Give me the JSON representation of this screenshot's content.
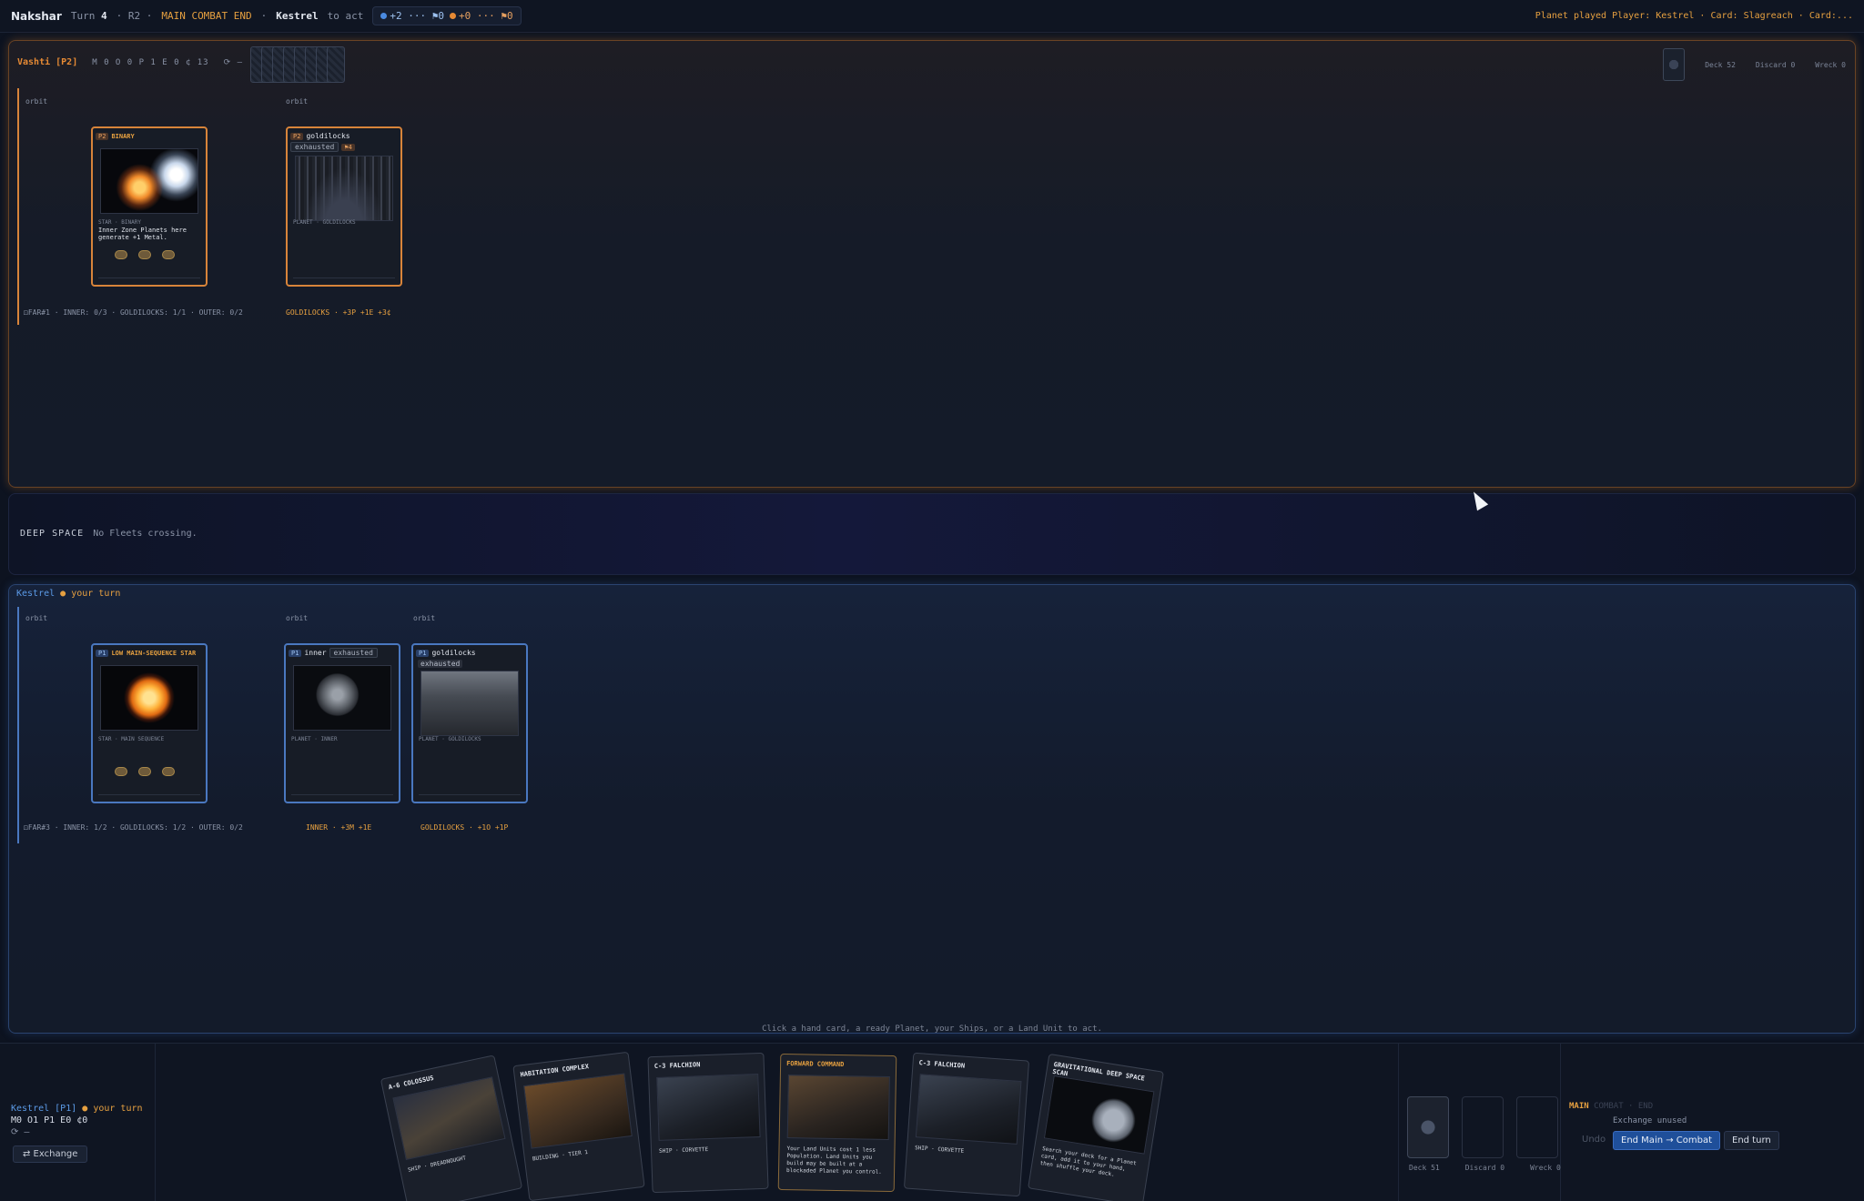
{
  "topbar": {
    "brand": "Nakshar",
    "turn_label": "Turn",
    "turn_num": "4",
    "round": "· R2 ·",
    "phase": "MAIN COMBAT END",
    "sep": "·",
    "active_player": "Kestrel",
    "to_act": "to act",
    "pill_blue": "+2 ··· ⚑0",
    "pill_orange": "+0 ··· ⚑0",
    "log": "Planet played Player: Kestrel · Card: Slagreach · Card:..."
  },
  "opponent": {
    "name": "Vashti [P2]",
    "resources": "M 0  O 0  P 1  E 0  ¢ 13",
    "extra": "⟳ —",
    "deck": "Deck 52",
    "discard": "Discard 0",
    "wreck": "Wreck 0",
    "lanes": [
      {
        "orbit": "orbit",
        "footer": "⚀FAR#1 · INNER: 0/3 · GOLDILOCKS: 1/1 · OUTER: 0/2"
      },
      {
        "orbit": "orbit",
        "footer": "GOLDILOCKS · +3P +1E +3¢"
      }
    ],
    "cards": [
      {
        "tag": "P2",
        "name": "BINARY",
        "type": "STAR · BINARY",
        "text": "Inner Zone Planets here generate +1 Metal.",
        "stats": [
          "3",
          "1",
          "3"
        ]
      },
      {
        "tag": "P2",
        "name": "goldilocks",
        "exhausted": "exhausted",
        "badge": "⚑4",
        "type": "PLANET · GOLDILOCKS"
      }
    ]
  },
  "deep_space": {
    "label": "DEEP SPACE",
    "status": "No Fleets crossing."
  },
  "mine": {
    "name": "Kestrel",
    "your_turn": "● your turn",
    "lanes": [
      {
        "orbit": "orbit",
        "footer": "⚀FAR#3 · INNER: 1/2 · GOLDILOCKS: 1/2 · OUTER: 0/2"
      },
      {
        "orbit": "orbit",
        "footer": "INNER · +3M +1E"
      },
      {
        "orbit": "orbit",
        "footer": "GOLDILOCKS · +1O +1P"
      }
    ],
    "cards": [
      {
        "tag": "P1",
        "name": "LOW MAIN-SEQUENCE STAR",
        "type": "STAR · MAIN SEQUENCE",
        "stats": [
          "2",
          "2",
          "2"
        ]
      },
      {
        "tag": "P1",
        "name": "inner",
        "exhausted": "exhausted",
        "type": "PLANET · INNER"
      },
      {
        "tag": "P1",
        "name": "goldilocks",
        "exhausted": "exhausted",
        "type": "PLANET · GOLDILOCKS"
      }
    ]
  },
  "hint": "Click a hand card, a ready Planet, your Ships, or a Land Unit to act.",
  "bottom": {
    "player": "Kestrel [P1]",
    "your_turn": "● your turn",
    "resources": "M0  O1  P1  E0  ¢0",
    "extra": "⟳ —",
    "exchange": "⇄ Exchange",
    "hand": [
      {
        "name": "A-6 COLOSSUS",
        "text": "SHIP · DREADNOUGHT"
      },
      {
        "name": "HABITATION COMPLEX",
        "text": "BUILDING · TIER 1"
      },
      {
        "name": "C-3 FALCHION",
        "text": "SHIP · CORVETTE"
      },
      {
        "name": "FORWARD COMMAND",
        "text": "Your Land Units cost 1 less Population. Land Units you build may be built at a blockaded Planet you control."
      },
      {
        "name": "C-3 FALCHION",
        "text": "SHIP · CORVETTE"
      },
      {
        "name": "GRAVITATIONAL DEEP SPACE SCAN",
        "text": "Search your deck for a Planet card, add it to your hand, then shuffle your deck."
      }
    ],
    "deck": "Deck 51",
    "discard": "Discard 0",
    "wreck": "Wreck 0",
    "phase": "MAIN",
    "phase_rest": "COMBAT · END",
    "exchange_unused": "Exchange unused",
    "undo": "Undo",
    "end_main": "End Main → Combat",
    "end_turn": "End turn"
  },
  "colors": {
    "opp_accent": "#d8843a",
    "mine_accent": "#4a78c0",
    "primary_button": "#1f4f9a"
  }
}
